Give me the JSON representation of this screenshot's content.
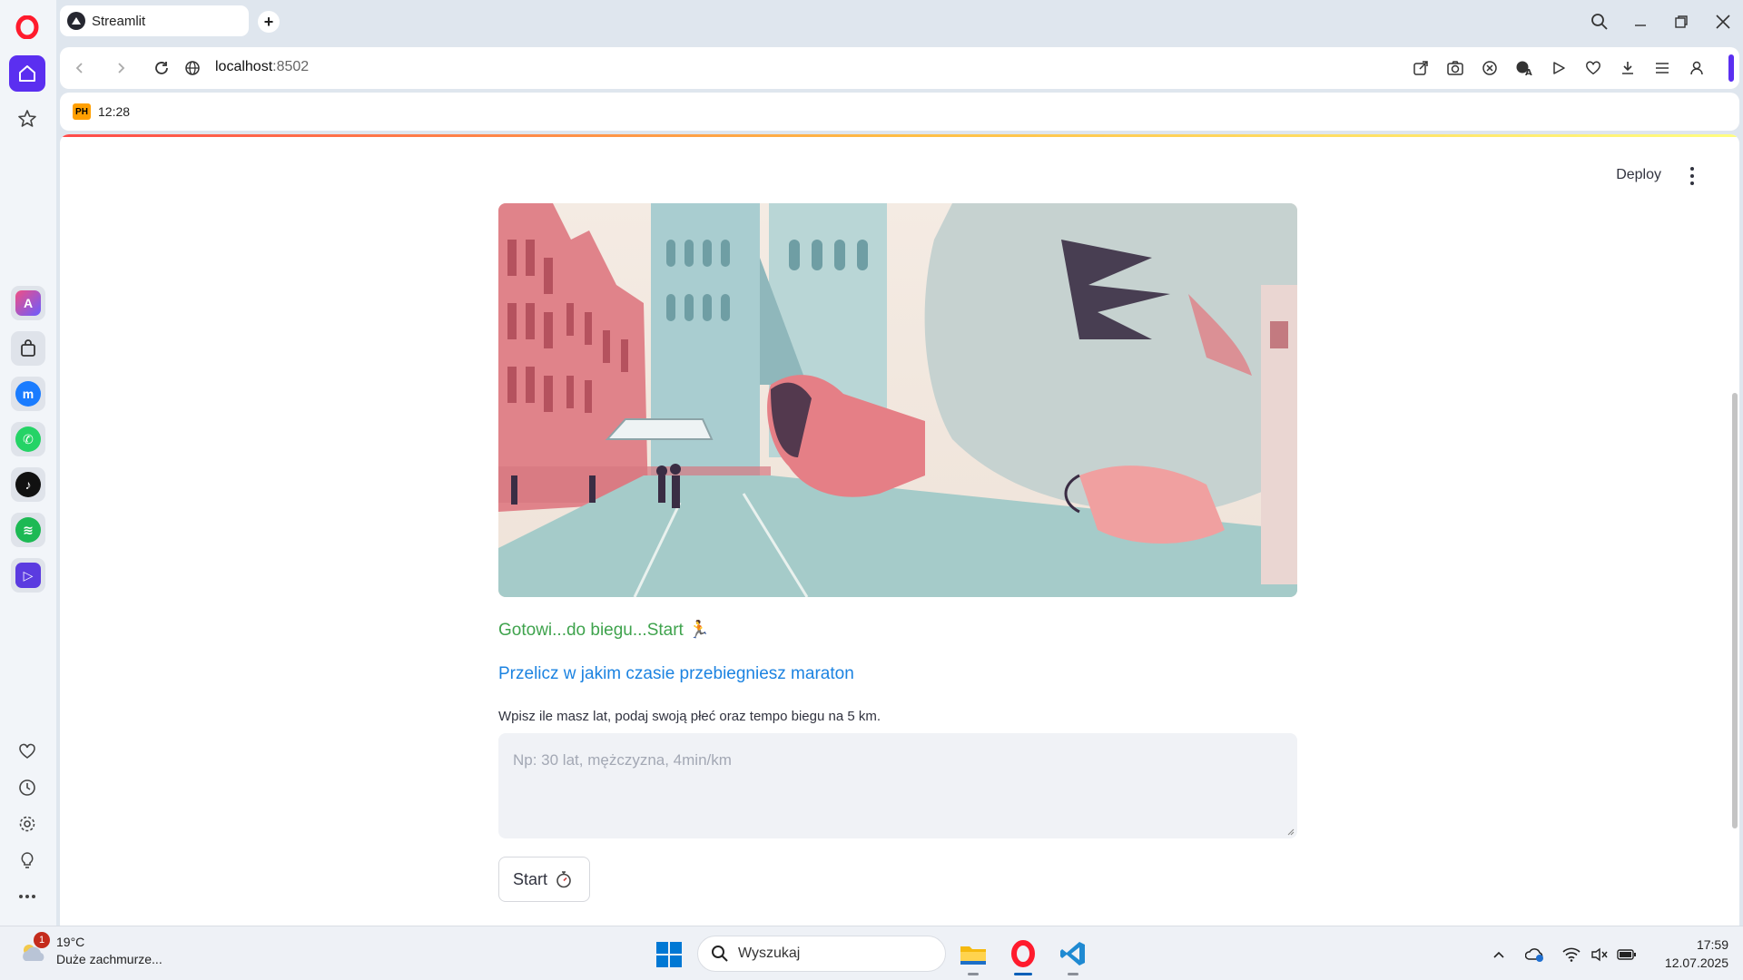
{
  "browser": {
    "tab_title": "Streamlit",
    "url_host": "localhost",
    "url_port": ":8502",
    "bookmark_label": "12:28",
    "bookmark_badge": "PH"
  },
  "app": {
    "deploy_label": "Deploy",
    "ready_text": "Gotowi...do biegu...Start 🏃",
    "subheader": "Przelicz w jakim czasie przebiegniesz maraton",
    "input_label": "Wpisz ile masz lat, podaj swoją płeć oraz tempo biegu na 5 km.",
    "input_placeholder": "Np: 30 lat, mężczyzna, 4min/km",
    "input_value": "",
    "start_label": "Start"
  },
  "colors": {
    "accent": "#ff4b4b",
    "success_text": "#3fa34d",
    "info_text": "#1c83e1",
    "opera_red": "#ff1b2d",
    "opera_accent": "#5b2ff0"
  },
  "taskbar": {
    "weather_temp": "19°C",
    "weather_desc": "Duże zachmurze...",
    "notification_count": "1",
    "search_label": "Wyszukaj",
    "time": "17:59",
    "date": "12.07.2025"
  },
  "icons": {
    "rail": [
      "opera-logo-icon",
      "home-icon",
      "star-icon",
      "aria-icon",
      "shopping-bag-icon",
      "messenger-icon",
      "whatsapp-icon",
      "tiktok-icon",
      "spotify-icon",
      "player-icon",
      "heart-icon",
      "history-icon",
      "settings-icon",
      "bulb-icon",
      "more-icon"
    ],
    "toolbar": [
      "share-icon",
      "camera-icon",
      "adblock-icon",
      "translate-icon",
      "flow-icon",
      "heart-icon",
      "download-icon",
      "menu-icon",
      "profile-icon"
    ],
    "start_button": "stopwatch-icon"
  }
}
